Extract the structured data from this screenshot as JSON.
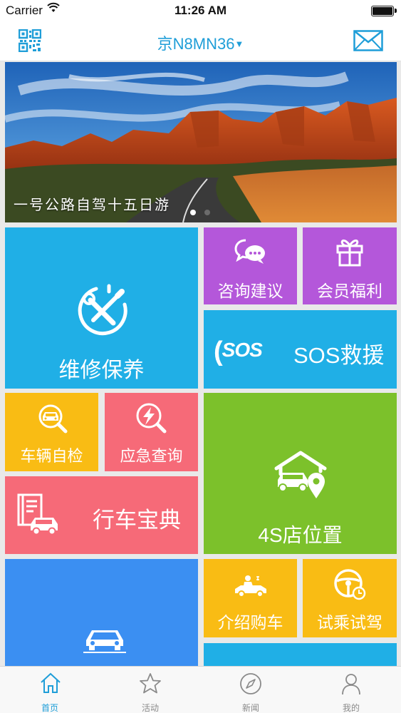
{
  "status_bar": {
    "carrier": "Carrier",
    "time": "11:26 AM"
  },
  "nav": {
    "title": "京N8MN36",
    "caret": "▼"
  },
  "banner": {
    "caption": "一号公路自驾十五日游",
    "pages": 2,
    "current_page": 1
  },
  "tiles": {
    "maintenance": "维修保养",
    "consult": "咨询建议",
    "member": "会员福利",
    "sos_badge": "SOS",
    "sos": "SOS救援",
    "selfcheck": "车辆自检",
    "emergency": "应急查询",
    "location": "4S店位置",
    "guide": "行车宝典",
    "intro": "介绍购车",
    "testdrive": "试乘试驾"
  },
  "tab_bar": {
    "items": [
      {
        "label": "首页",
        "icon": "home-icon",
        "active": true
      },
      {
        "label": "活动",
        "icon": "star-icon",
        "active": false
      },
      {
        "label": "新闻",
        "icon": "compass-icon",
        "active": false
      },
      {
        "label": "我的",
        "icon": "user-icon",
        "active": false
      }
    ]
  },
  "colors": {
    "accent": "#1f9ed8",
    "tile_blue": "#20afe6",
    "tile_purple": "#b457da",
    "tile_yellow": "#f9bc14",
    "tile_pink": "#f66a78",
    "tile_green": "#7cc12b",
    "tile_bright_blue": "#3b8ff2"
  }
}
